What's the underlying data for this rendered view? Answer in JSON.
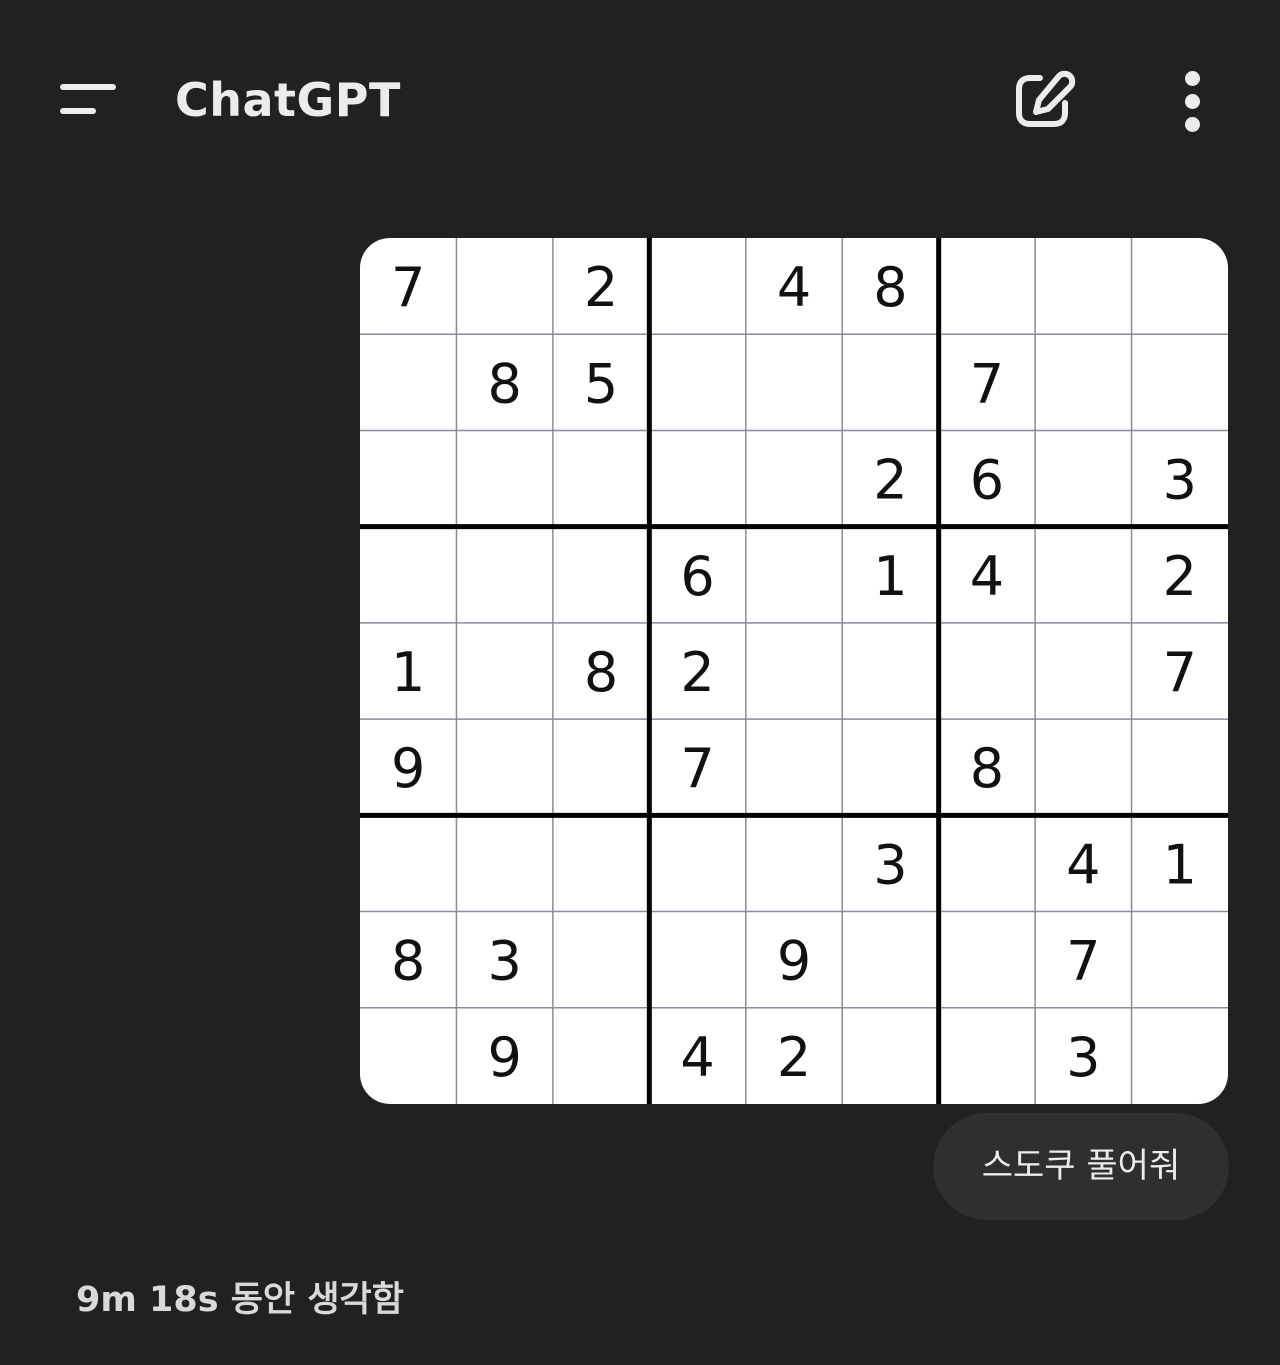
{
  "header": {
    "title": "ChatGPT",
    "menu_icon": "hamburger-menu-icon",
    "new_chat_icon": "edit-square-icon",
    "more_icon": "vertical-ellipsis-icon"
  },
  "message": {
    "image": {
      "type": "sudoku-puzzle",
      "grid": [
        [
          "7",
          "",
          "2",
          "",
          "4",
          "8",
          "",
          "",
          ""
        ],
        [
          "",
          "8",
          "5",
          "",
          "",
          "",
          "7",
          "",
          ""
        ],
        [
          "",
          "",
          "",
          "",
          "",
          "2",
          "6",
          "",
          "3"
        ],
        [
          "",
          "",
          "",
          "6",
          "",
          "1",
          "4",
          "",
          "2"
        ],
        [
          "1",
          "",
          "8",
          "2",
          "",
          "",
          "",
          "",
          "7"
        ],
        [
          "9",
          "",
          "",
          "7",
          "",
          "",
          "8",
          "",
          ""
        ],
        [
          "",
          "",
          "",
          "",
          "",
          "3",
          "",
          "4",
          "1"
        ],
        [
          "8",
          "3",
          "",
          "",
          "9",
          "",
          "",
          "7",
          ""
        ],
        [
          "",
          "9",
          "",
          "4",
          "2",
          "",
          "",
          "3",
          ""
        ]
      ]
    },
    "text": "스도쿠 풀어줘"
  },
  "response": {
    "thinking_label": "9m 18s 동안 생각함"
  },
  "colors": {
    "background": "#212121",
    "bubble": "#2f2f2f",
    "text": "#ececec"
  }
}
